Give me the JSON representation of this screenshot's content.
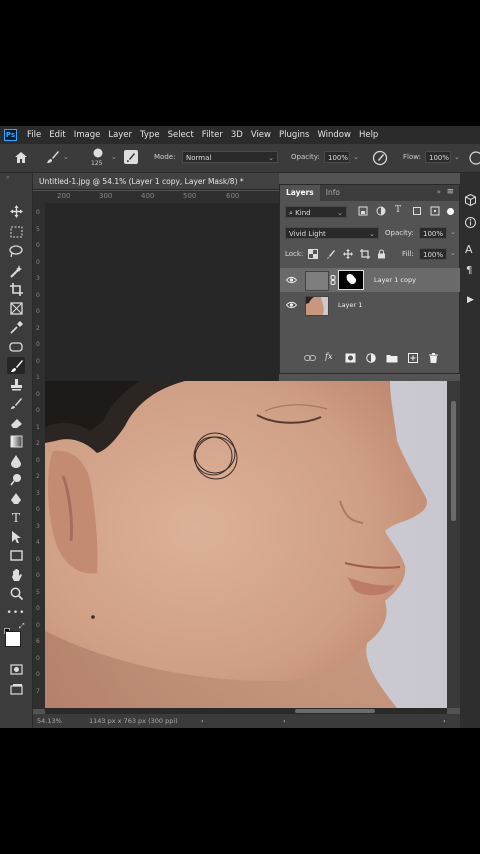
{
  "app": {
    "logo": "Ps"
  },
  "menubar": {
    "items": [
      "File",
      "Edit",
      "Image",
      "Layer",
      "Type",
      "Select",
      "Filter",
      "3D",
      "View",
      "Plugins",
      "Window",
      "Help"
    ]
  },
  "options": {
    "brush_size": "125",
    "mode_label": "Mode:",
    "mode_value": "Normal",
    "opacity_label": "Opacity:",
    "opacity_value": "100%",
    "flow_label": "Flow:",
    "flow_value": "100%"
  },
  "document": {
    "tab_title": "Untitled-1.jpg @ 54.1% (Layer 1 copy, Layer Mask/8) *",
    "ruler_top": [
      "200",
      "300",
      "400",
      "500",
      "600"
    ],
    "ruler_left": [
      "0",
      "5",
      "0",
      "0",
      "3",
      "0",
      "0",
      "2",
      "0",
      "0",
      "1",
      "0",
      "0",
      "1",
      "2",
      "0",
      "2",
      "3",
      "0",
      "3",
      "4",
      "0",
      "0",
      "5",
      "0",
      "0",
      "6",
      "0",
      "0",
      "7"
    ]
  },
  "layers_panel": {
    "tabs": [
      "Layers",
      "Info"
    ],
    "filter_label": "Kind",
    "blend_mode": "Vivid Light",
    "opacity_label": "Opacity:",
    "opacity_value": "100%",
    "lock_label": "Lock:",
    "fill_label": "Fill:",
    "fill_value": "100%",
    "layers": [
      {
        "name": "Layer 1 copy",
        "selected": true
      },
      {
        "name": "Layer 1",
        "selected": false
      }
    ],
    "footer_icons": [
      "link-icon",
      "fx-icon",
      "mask-icon",
      "adjustment-icon",
      "group-icon",
      "new-layer-icon",
      "trash-icon"
    ]
  },
  "status": {
    "zoom": "54.13%",
    "info": "1143 px x 763 px (300 ppi)"
  },
  "colors": {
    "ui_dark": "#3c3c3c",
    "ui_mid": "#535353",
    "selected_layer": "#6a6a6a",
    "accent": "#31a8ff"
  }
}
